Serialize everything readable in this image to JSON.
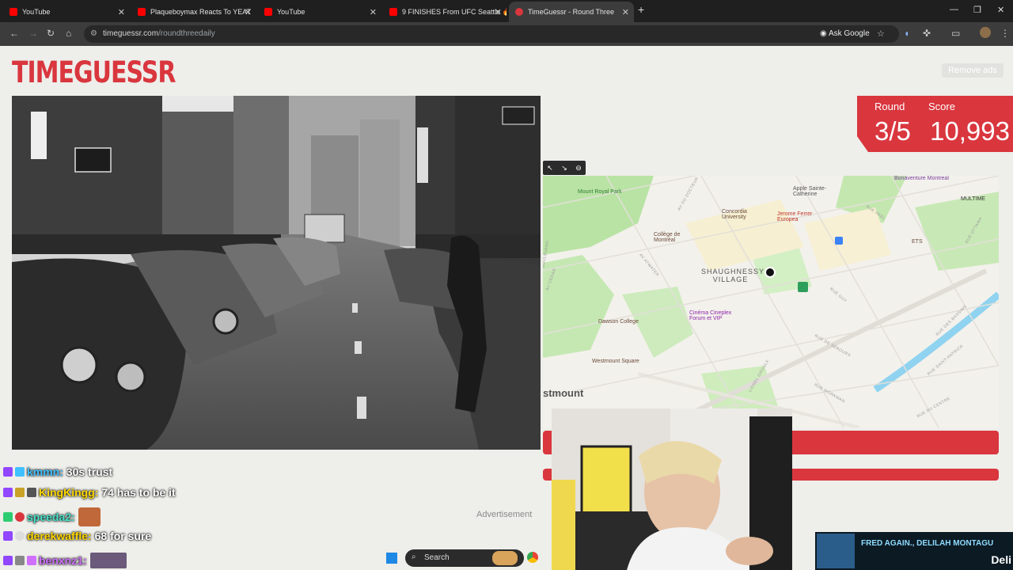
{
  "browser": {
    "tabs": [
      {
        "title": "YouTube",
        "color": "#ff0000"
      },
      {
        "title": "Plaqueboymax Reacts To YEAT",
        "color": "#ff0000"
      },
      {
        "title": "YouTube",
        "color": "#ff0000"
      },
      {
        "title": "9 FINISHES From UFC Seattle 🔥",
        "color": "#ff0000"
      },
      {
        "title": "TimeGuessr - Round Three",
        "color": "#d9363e"
      }
    ],
    "new_tab": "+",
    "url_domain": "timeguessr.com",
    "url_path": "/roundthreedaily",
    "ask_google": "Ask Google"
  },
  "site": {
    "logo": "TIMEGUESSR",
    "remove_ads": "Remove ads",
    "round_label": "Round",
    "round_value": "3/5",
    "score_label": "Score",
    "score_value": "10,993",
    "advertisement": "Advertisement",
    "accent": "#d9363e"
  },
  "map": {
    "partial_label": "stmount",
    "places": [
      {
        "name": "Mount Royal Park"
      },
      {
        "name": "Apple Sainte-Catherine"
      },
      {
        "name": "Bonaventure Montreal"
      },
      {
        "name": "Concordia University"
      },
      {
        "name": "Jerome Ferrer Europea"
      },
      {
        "name": "MULTIME"
      },
      {
        "name": "Collège de Montréal"
      },
      {
        "name": "ETS"
      },
      {
        "name": "SHAUGHNESSY VILLAGE"
      },
      {
        "name": "Cinéma Cineplex Forum et VIP"
      },
      {
        "name": "Dawson College"
      },
      {
        "name": "Westmount Square"
      }
    ],
    "streets": [
      "AV DU DOCTEUR",
      "RUE PEEL",
      "AV LINCOLN",
      "AV ATWATER",
      "RUE GUY",
      "RUE DES BASSINS",
      "RUE DE SÉBOURS",
      "RUE SAINT-PATRICK",
      "RUE DU CENTRE",
      "RUE WORKMAN",
      "LIONEL GROULX",
      "AV CEDAR",
      "RUE DE LA MONTAGNE",
      "BOULEVARD",
      "RUE OTTAWA"
    ]
  },
  "chat": [
    {
      "user": "kmmn",
      "message": "30s trust",
      "color": "#40c0ff"
    },
    {
      "user": "KingKingg",
      "message": "74 has to be it",
      "color": "#ffd700"
    },
    {
      "user": "speeda2",
      "message": "",
      "color": "#48e0c8"
    },
    {
      "user": "derekwaffle",
      "message": "68 for sure",
      "color": "#ffd700"
    },
    {
      "user": "benxnz1",
      "message": "",
      "color": "#d070ff"
    }
  ],
  "taskbar": {
    "search": "Search"
  },
  "music": {
    "title": "FRED AGAIN., DELILAH MONTAGU",
    "sub": "Deli"
  }
}
